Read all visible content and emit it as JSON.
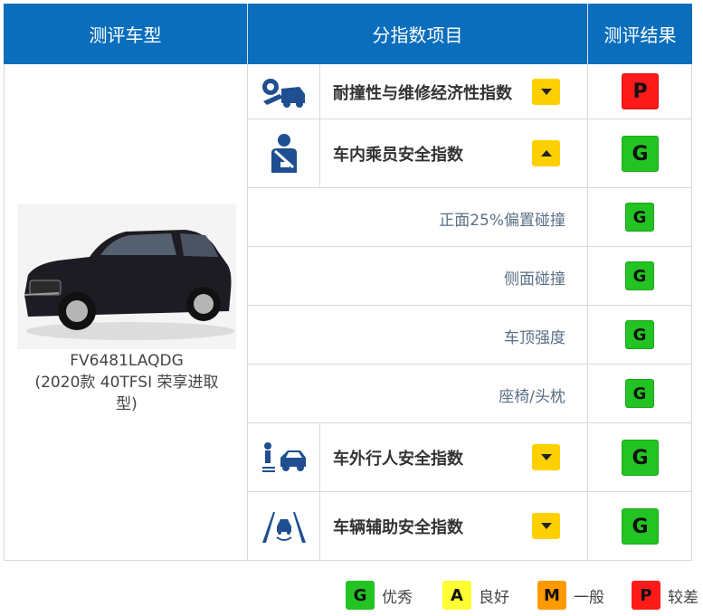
{
  "colors": {
    "header_bg": "#0a6ebd",
    "good": "#22c322",
    "acceptable": "#ffff33",
    "marginal": "#ff9900",
    "poor": "#ff1a1a",
    "toggle": "#ffd000"
  },
  "header": {
    "col_model": "测评车型",
    "col_items": "分指数项目",
    "col_result": "测评结果"
  },
  "vehicle": {
    "model_code": "FV6481LAQDG",
    "variant": "(2020款 40TFSI 荣享进取型)",
    "image_icon": "suv-photo"
  },
  "indices": [
    {
      "icon": "repair-economy-icon",
      "label": "耐撞性与维修经济性指数",
      "toggle": "expand",
      "rating": "P"
    },
    {
      "icon": "occupant-safety-icon",
      "label": "车内乘员安全指数",
      "toggle": "collapse",
      "rating": "G",
      "subitems": [
        {
          "label": "正面25%偏置碰撞",
          "rating": "G"
        },
        {
          "label": "侧面碰撞",
          "rating": "G"
        },
        {
          "label": "车顶强度",
          "rating": "G"
        },
        {
          "label": "座椅/头枕",
          "rating": "G"
        }
      ]
    },
    {
      "icon": "pedestrian-safety-icon",
      "label": "车外行人安全指数",
      "toggle": "expand",
      "rating": "G"
    },
    {
      "icon": "driver-assist-icon",
      "label": "车辆辅助安全指数",
      "toggle": "expand",
      "rating": "G"
    }
  ],
  "legend": [
    {
      "code": "G",
      "text": "优秀"
    },
    {
      "code": "A",
      "text": "良好"
    },
    {
      "code": "M",
      "text": "一般"
    },
    {
      "code": "P",
      "text": "较差"
    }
  ]
}
